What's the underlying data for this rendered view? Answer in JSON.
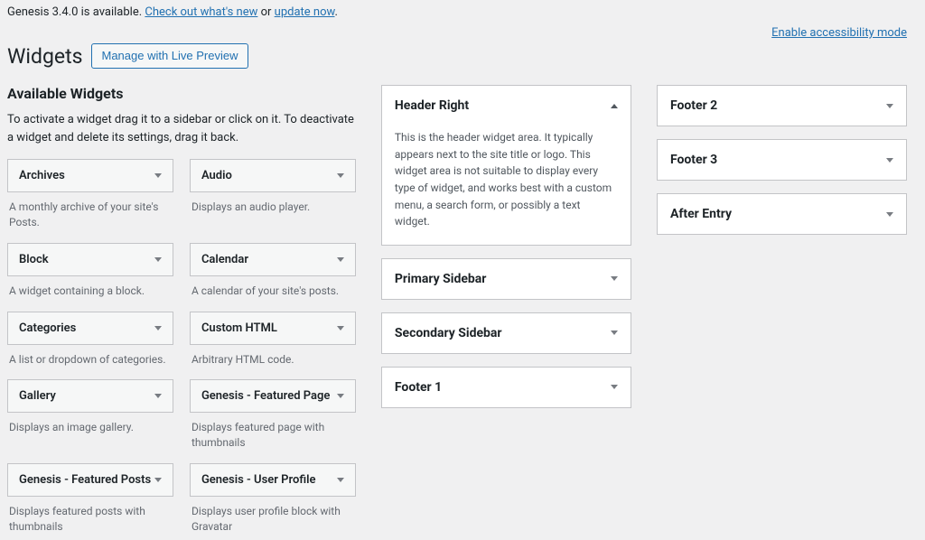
{
  "notice": {
    "prefix": "Genesis 3.4.0 is available. ",
    "link1": "Check out what's new",
    "middle": " or ",
    "link2": "update now",
    "suffix": "."
  },
  "accessibility_link": "Enable accessibility mode",
  "page_title": "Widgets",
  "manage_button": "Manage with Live Preview",
  "available": {
    "title": "Available Widgets",
    "desc": "To activate a widget drag it to a sidebar or click on it. To deactivate a widget and delete its settings, drag it back.",
    "items": [
      {
        "name": "Archives",
        "desc": "A monthly archive of your site's Posts."
      },
      {
        "name": "Audio",
        "desc": "Displays an audio player."
      },
      {
        "name": "Block",
        "desc": "A widget containing a block."
      },
      {
        "name": "Calendar",
        "desc": "A calendar of your site's posts."
      },
      {
        "name": "Categories",
        "desc": "A list or dropdown of categories."
      },
      {
        "name": "Custom HTML",
        "desc": "Arbitrary HTML code."
      },
      {
        "name": "Gallery",
        "desc": "Displays an image gallery."
      },
      {
        "name": "Genesis - Featured Page",
        "desc": "Displays featured page with thumbnails"
      },
      {
        "name": "Genesis - Featured Posts",
        "desc": "Displays featured posts with thumbnails"
      },
      {
        "name": "Genesis - User Profile",
        "desc": "Displays user profile block with Gravatar"
      }
    ]
  },
  "areas_mid": [
    {
      "name": "Header Right",
      "open": true,
      "desc": "This is the header widget area. It typically appears next to the site title or logo. This widget area is not suitable to display every type of widget, and works best with a custom menu, a search form, or possibly a text widget."
    },
    {
      "name": "Primary Sidebar",
      "open": false
    },
    {
      "name": "Secondary Sidebar",
      "open": false
    },
    {
      "name": "Footer 1",
      "open": false
    }
  ],
  "areas_right": [
    {
      "name": "Footer 2",
      "open": false
    },
    {
      "name": "Footer 3",
      "open": false
    },
    {
      "name": "After Entry",
      "open": false
    }
  ]
}
